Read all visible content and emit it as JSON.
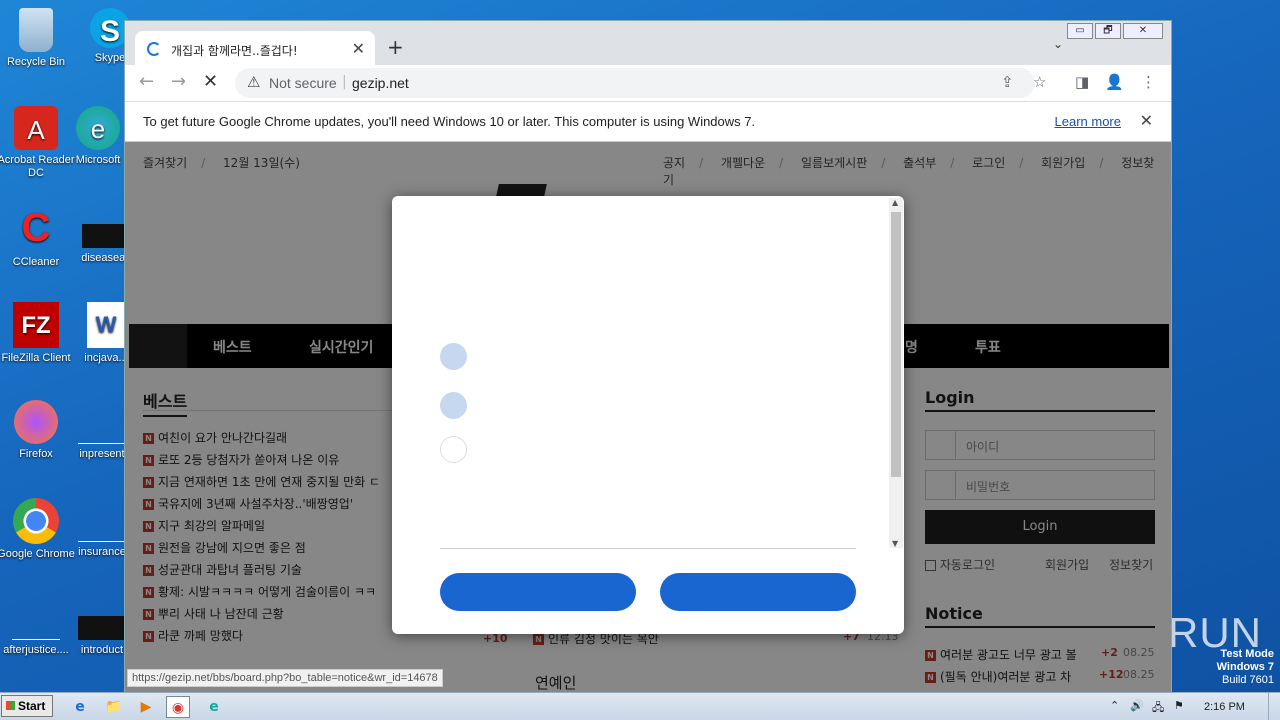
{
  "desktop": {
    "icons": [
      {
        "label": "Recycle Bin",
        "glyph": "🗑"
      },
      {
        "label": "Skype",
        "glyph": "S"
      },
      {
        "label": "Acrobat Reader DC",
        "glyph": "A"
      },
      {
        "label": "Microsoft",
        "glyph": "e"
      },
      {
        "label": "CCleaner",
        "glyph": "C"
      },
      {
        "label": "diseaseas",
        "glyph": ""
      },
      {
        "label": "FileZilla Client",
        "glyph": "FZ"
      },
      {
        "label": "incjava...",
        "glyph": "W"
      },
      {
        "label": "Firefox",
        "glyph": "🦊"
      },
      {
        "label": "inpresent",
        "glyph": ""
      },
      {
        "label": "Google Chrome",
        "glyph": "◉"
      },
      {
        "label": "insurance",
        "glyph": ""
      },
      {
        "label": "afterjustice....",
        "glyph": ""
      },
      {
        "label": "introduct",
        "glyph": ""
      }
    ]
  },
  "browser": {
    "tab_title": "개집과 함께라면..즐겁다!",
    "tab_close": "✕",
    "new_tab": "+",
    "tab_dropdown": "⌄",
    "window_buttons": [
      "▭",
      "🗗",
      "✕"
    ],
    "back": "←",
    "forward": "→",
    "stop": "✕",
    "security": "Not secure",
    "security_icon": "⚠",
    "url": "gezip.net",
    "omni_icons": [
      "⇪",
      "☆"
    ],
    "toolbar_icons": [
      "◨",
      "👤",
      "⋮"
    ],
    "infobar_message": "To get future Google Chrome updates, you'll need Windows 10 or later. This computer is using Windows 7.",
    "learn_more": "Learn more",
    "infobar_close": "✕",
    "status_url": "https://gezip.net/bbs/board.php?bo_table=notice&wr_id=14678"
  },
  "site": {
    "util_left": [
      "즐겨찾기",
      "12월 13일(수)"
    ],
    "util_right": [
      "공지",
      "개펠다운",
      "일름보게시판",
      "출석부",
      "로그인",
      "회원가입",
      "정보찾기"
    ],
    "nav_home_icon": "",
    "nav": [
      "베스트",
      "실시간인기",
      "명",
      "투표"
    ],
    "nav_icons": [
      "",
      "",
      ""
    ],
    "best_title": "베스트",
    "best_badge": "N",
    "best_items": [
      "여친이 요가 안나간다길래",
      "로또 2등 당첨자가 쏟아져 나온 이유",
      "지금 연재하면 1초 만에 연재 중지될 만화 ㄷ",
      "국유지에 3년째 사설주차장..'배짱영업'",
      "지구 최강의 알파메일",
      "원전을 강남에 지으면 좋은 점",
      "성균관대 과탑녀 플러팅 기술",
      "황제: 시발ㅋㅋㅋㅋ 어떻게 검술이름이 ㅋㅋ",
      "뿌리 사태 나 남잔데 근황",
      "라쿤 까페 망했다"
    ],
    "best_last_count": "+10",
    "mid_item": "인류 김정 맛이는 목안",
    "mid_count": "+7",
    "mid_date": "12.13",
    "entertain_title": "연예인",
    "login_title": "Login",
    "id_placeholder": "아이디",
    "pw_placeholder": "비밀번호",
    "id_icon": "",
    "pw_icon": "",
    "login_button": " Login",
    "auto_login": "자동로그인",
    "join": "회원가입",
    "find": "정보찾기",
    "notice_title": "Notice",
    "notice_items": [
      {
        "text": "여러분 광고도 너무 광고 볼",
        "count": "+2",
        "date": "08.25"
      },
      {
        "text": "(필독 안내)여러분 광고 차",
        "count": "+12",
        "date": "08.25"
      }
    ]
  },
  "dialog": {
    "scroll_up": "▲",
    "scroll_down": "▼",
    "options": [
      {
        "state": "filled"
      },
      {
        "state": "filled"
      },
      {
        "state": "empty"
      }
    ],
    "buttons": [
      "",
      ""
    ]
  },
  "taskbar": {
    "start": "Start",
    "apps": [
      "ie",
      "explorer",
      "media",
      "chrome",
      "edge"
    ],
    "app_glyphs": [
      "e",
      "📁",
      "▶",
      "◉",
      "e"
    ],
    "tray_up": "⌃",
    "tray_icons": [
      "🔊",
      "🖧",
      "⚑"
    ],
    "time": "2:16 PM"
  },
  "watermark": {
    "brand": "ANY ▷ RUN",
    "line1": "Test Mode",
    "line2": "Windows 7",
    "line3": "Build 7601"
  }
}
